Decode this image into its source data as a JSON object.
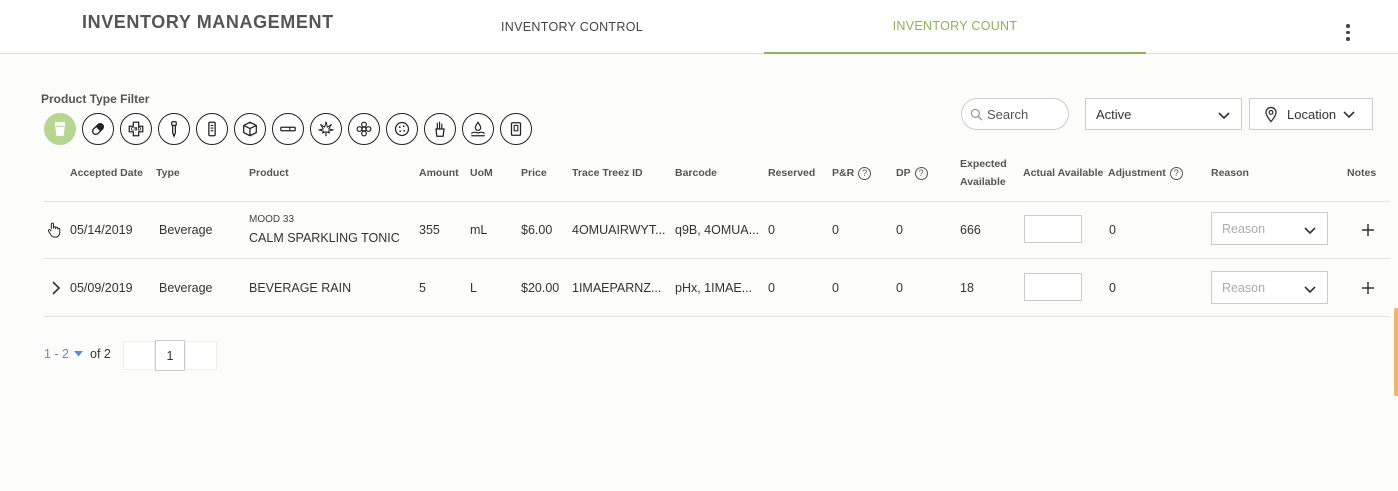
{
  "app": {
    "title": "INVENTORY MANAGEMENT"
  },
  "tabs": [
    {
      "label": "INVENTORY CONTROL",
      "active": false
    },
    {
      "label": "INVENTORY COUNT",
      "active": true
    }
  ],
  "colors": {
    "accent": "#8bb452",
    "active_filter": "#b7d691",
    "link": "#5b8fc7",
    "edge_tab": "#f3b660"
  },
  "filter": {
    "label": "Product Type Filter",
    "icons": [
      "beverage-cup-icon",
      "pill-icon",
      "cbd-cross-icon",
      "dropper-icon",
      "vape-cartridge-icon",
      "package-box-icon",
      "pre-roll-icon",
      "cannabis-leaf-icon",
      "flower-icon",
      "edible-cookie-icon",
      "extract-icon",
      "topical-hand-icon",
      "misc-icon"
    ]
  },
  "search": {
    "placeholder": "Search"
  },
  "status_filter": {
    "value": "Active"
  },
  "location_filter": {
    "label": "Location"
  },
  "columns": {
    "accepted_date": "Accepted Date",
    "type": "Type",
    "product": "Product",
    "amount": "Amount",
    "uom": "UoM",
    "price": "Price",
    "trace": "Trace Treez ID",
    "barcode": "Barcode",
    "reserved": "Reserved",
    "pr": "P&R",
    "dp": "DP",
    "expected_1": "Expected",
    "expected_2": "Available",
    "actual": "Actual Available",
    "adjustment": "Adjustment",
    "reason": "Reason",
    "notes": "Notes"
  },
  "rows": [
    {
      "date": "05/14/2019",
      "type": "Beverage",
      "brand": "MOOD 33",
      "product": "CALM SPARKLING TONIC",
      "amount": "355",
      "uom": "mL",
      "price": "$6.00",
      "trace": "4OMUAIRWYT...",
      "barcode": "q9B, 4OMUA...",
      "reserved": "0",
      "pr": "0",
      "dp": "0",
      "expected": "666",
      "adjustment": "0",
      "reason_placeholder": "Reason"
    },
    {
      "date": "05/09/2019",
      "type": "Beverage",
      "brand": "",
      "product": "BEVERAGE RAIN",
      "amount": "5",
      "uom": "L",
      "price": "$20.00",
      "trace": "1IMAEPARNZ...",
      "barcode": "pHx, 1IMAE...",
      "reserved": "0",
      "pr": "0",
      "dp": "0",
      "expected": "18",
      "adjustment": "0",
      "reason_placeholder": "Reason"
    }
  ],
  "pagination": {
    "range": "1 - 2",
    "total": "of 2",
    "current": "1"
  }
}
